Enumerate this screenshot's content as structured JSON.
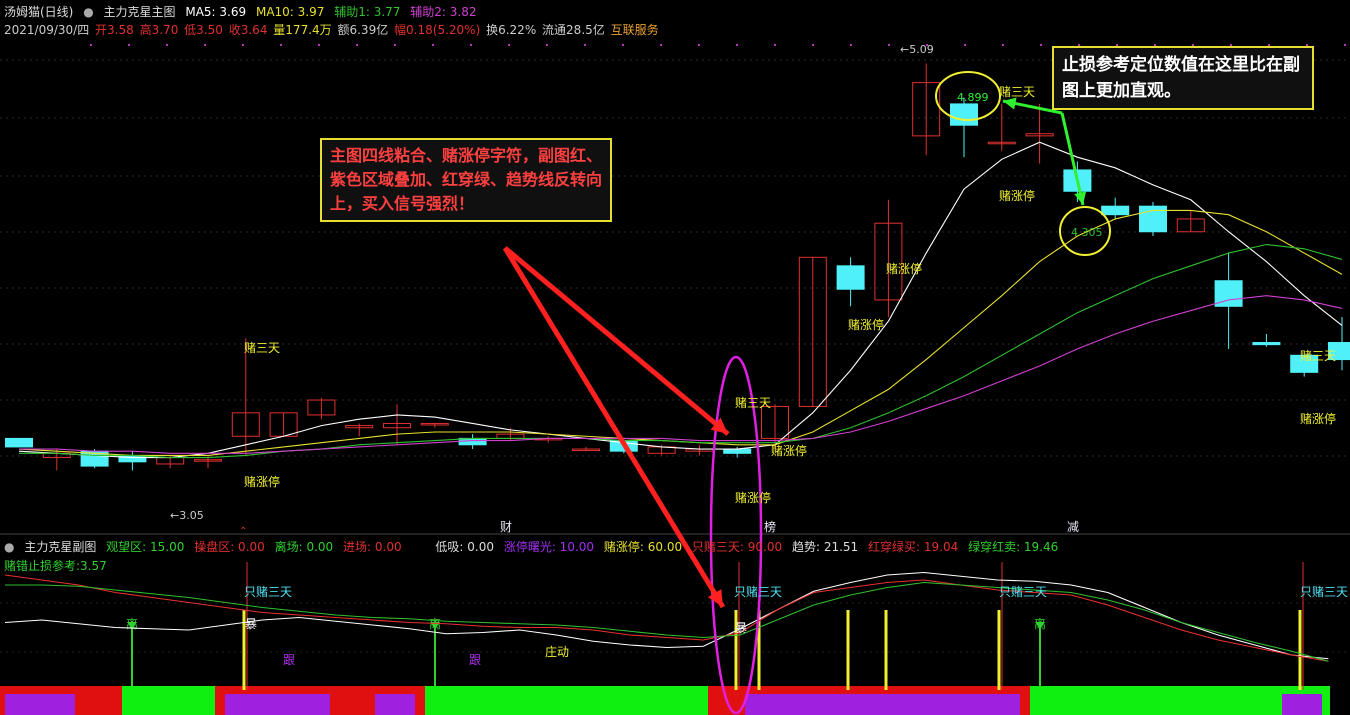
{
  "header": {
    "stock_name": "汤姆猫(日线)",
    "main_indicator": "主力克星主图",
    "ma5": "MA5: 3.69",
    "ma10": "MA10: 3.97",
    "aux1": "辅助1: 3.77",
    "aux2": "辅助2: 3.82"
  },
  "quote": {
    "date": "2021/09/30/四",
    "open": "开3.58",
    "high": "高3.70",
    "low": "低3.50",
    "close": "收3.64",
    "volume": "量177.4万",
    "amount": "额6.39亿",
    "change": "幅0.18(5.20%)",
    "turnover": "换6.22%",
    "float": "流通28.5亿",
    "sector": "互联服务"
  },
  "sub_header": {
    "indicator": "主力克星副图",
    "watch": "观望区: 15.00",
    "control": "操盘区: 0.00",
    "exit": "离场: 0.00",
    "enter": "进场: 0.00",
    "low_buy": "低吸: 0.00",
    "limit_dawn": "涨停曙光: 10.00",
    "bet_limit": "赌涨停: 60.00",
    "only_bet": "只赌三天: 90.00",
    "trend": "趋势: 21.51",
    "red_green_buy": "红穿绿买: 19.04",
    "green_red_sell": "绿穿红卖: 19.46"
  },
  "stoploss_label": "赌错止损参考:3.57",
  "callout_left": "主图四线粘合、赌涨停字符，副图红、紫色区域叠加、红穿绿、趋势线反转向上，买入信号强烈！",
  "callout_right": "止损参考定位数值在这里比在副图上更加直观。",
  "labels": {
    "high_price": "5.09",
    "low_price": "3.05",
    "stop1": "4.899",
    "stop2": "4.305",
    "bet3": "赌三天",
    "bet_limit": "赌涨停",
    "only3": "只赌三天",
    "leave": "离",
    "follow": "跟",
    "boom": "暴",
    "dealer": "庄动",
    "ev_cai": "财",
    "ev_bang": "榜",
    "ev_jian": "减"
  },
  "colors": {
    "up": "#e03030",
    "down": "#50f0f8",
    "ma_white": "#ffffff",
    "ma_yellow": "#e8e030",
    "ma_green": "#30c030",
    "ma_magenta": "#d040d0"
  },
  "chart_data": [
    {
      "type": "candlestick",
      "title": "主力克星主图",
      "ylim": [
        2.9,
        5.2
      ],
      "candles": [
        {
          "o": 3.33,
          "c": 3.29,
          "h": 3.33,
          "l": 3.29
        },
        {
          "o": 3.24,
          "c": 3.26,
          "h": 3.28,
          "l": 3.18
        },
        {
          "o": 3.27,
          "c": 3.2,
          "h": 3.28,
          "l": 3.19
        },
        {
          "o": 3.25,
          "c": 3.22,
          "h": 3.27,
          "l": 3.18
        },
        {
          "o": 3.21,
          "c": 3.24,
          "h": 3.25,
          "l": 3.19
        },
        {
          "o": 3.23,
          "c": 3.23,
          "h": 3.25,
          "l": 3.19
        },
        {
          "o": 3.34,
          "c": 3.45,
          "h": 3.8,
          "l": 3.25
        },
        {
          "o": 3.34,
          "c": 3.45,
          "h": 3.45,
          "l": 3.34
        },
        {
          "o": 3.44,
          "c": 3.51,
          "h": 3.52,
          "l": 3.42
        },
        {
          "o": 3.38,
          "c": 3.39,
          "h": 3.4,
          "l": 3.34
        },
        {
          "o": 3.38,
          "c": 3.4,
          "h": 3.49,
          "l": 3.3
        },
        {
          "o": 3.4,
          "c": 3.4,
          "h": 3.4,
          "l": 3.38
        },
        {
          "o": 3.33,
          "c": 3.3,
          "h": 3.35,
          "l": 3.28
        },
        {
          "o": 3.33,
          "c": 3.35,
          "h": 3.38,
          "l": 3.32
        },
        {
          "o": 3.33,
          "c": 3.33,
          "h": 3.34,
          "l": 3.31
        },
        {
          "o": 3.28,
          "c": 3.28,
          "h": 3.29,
          "l": 3.27
        },
        {
          "o": 3.32,
          "c": 3.27,
          "h": 3.33,
          "l": 3.26
        },
        {
          "o": 3.26,
          "c": 3.29,
          "h": 3.3,
          "l": 3.25
        },
        {
          "o": 3.27,
          "c": 3.28,
          "h": 3.3,
          "l": 3.25
        },
        {
          "o": 3.28,
          "c": 3.26,
          "h": 3.29,
          "l": 3.24
        },
        {
          "o": 3.33,
          "c": 3.48,
          "h": 3.49,
          "l": 3.28
        },
        {
          "o": 3.48,
          "c": 4.18,
          "h": 4.18,
          "l": 3.48
        },
        {
          "o": 4.14,
          "c": 4.03,
          "h": 4.18,
          "l": 3.95
        },
        {
          "o": 3.98,
          "c": 4.34,
          "h": 4.45,
          "l": 3.9
        },
        {
          "o": 4.75,
          "c": 5.0,
          "h": 5.09,
          "l": 4.66
        },
        {
          "o": 4.9,
          "c": 4.8,
          "h": 4.93,
          "l": 4.65
        },
        {
          "o": 4.72,
          "c": 4.72,
          "h": 4.9,
          "l": 4.68
        },
        {
          "o": 4.75,
          "c": 4.76,
          "h": 4.9,
          "l": 4.62
        },
        {
          "o": 4.59,
          "c": 4.49,
          "h": 4.63,
          "l": 4.44
        },
        {
          "o": 4.42,
          "c": 4.38,
          "h": 4.46,
          "l": 4.36
        },
        {
          "o": 4.42,
          "c": 4.3,
          "h": 4.44,
          "l": 4.28
        },
        {
          "o": 4.3,
          "c": 4.36,
          "h": 4.4,
          "l": 4.3
        },
        {
          "o": 4.07,
          "c": 3.95,
          "h": 4.2,
          "l": 3.75
        },
        {
          "o": 3.78,
          "c": 3.77,
          "h": 3.82,
          "l": 3.76
        },
        {
          "o": 3.72,
          "c": 3.64,
          "h": 3.72,
          "l": 3.62
        },
        {
          "o": 3.78,
          "c": 3.7,
          "h": 3.9,
          "l": 3.65
        }
      ],
      "series": [
        {
          "name": "MA5",
          "values": [
            3.27,
            3.26,
            3.25,
            3.24,
            3.24,
            3.26,
            3.3,
            3.34,
            3.39,
            3.42,
            3.44,
            3.43,
            3.4,
            3.37,
            3.35,
            3.33,
            3.31,
            3.29,
            3.28,
            3.28,
            3.3,
            3.45,
            3.65,
            3.88,
            4.2,
            4.5,
            4.64,
            4.72,
            4.65,
            4.6,
            4.52,
            4.45,
            4.3,
            4.16,
            4.0,
            3.86
          ]
        },
        {
          "name": "MA10",
          "values": [
            3.28,
            3.27,
            3.26,
            3.25,
            3.25,
            3.25,
            3.27,
            3.29,
            3.31,
            3.33,
            3.35,
            3.36,
            3.36,
            3.36,
            3.35,
            3.34,
            3.33,
            3.32,
            3.31,
            3.3,
            3.3,
            3.36,
            3.46,
            3.56,
            3.7,
            3.85,
            4.0,
            4.16,
            4.28,
            4.36,
            4.4,
            4.4,
            4.38,
            4.3,
            4.2,
            4.1
          ]
        },
        {
          "name": "辅助1",
          "values": [
            3.26,
            3.26,
            3.25,
            3.25,
            3.24,
            3.24,
            3.25,
            3.27,
            3.28,
            3.3,
            3.31,
            3.32,
            3.33,
            3.33,
            3.33,
            3.33,
            3.32,
            3.32,
            3.31,
            3.31,
            3.31,
            3.33,
            3.38,
            3.45,
            3.53,
            3.62,
            3.72,
            3.82,
            3.92,
            4.0,
            4.08,
            4.14,
            4.2,
            4.24,
            4.22,
            4.17
          ]
        },
        {
          "name": "辅助2",
          "values": [
            3.28,
            3.28,
            3.27,
            3.27,
            3.26,
            3.26,
            3.26,
            3.27,
            3.28,
            3.29,
            3.3,
            3.31,
            3.32,
            3.32,
            3.33,
            3.33,
            3.33,
            3.33,
            3.32,
            3.32,
            3.32,
            3.33,
            3.36,
            3.41,
            3.47,
            3.53,
            3.6,
            3.67,
            3.75,
            3.82,
            3.88,
            3.93,
            3.98,
            4.0,
            3.98,
            3.94
          ]
        }
      ]
    },
    {
      "type": "line",
      "title": "主力克星副图",
      "series": [
        {
          "name": "趋势",
          "values": [
            50,
            52,
            49,
            46,
            45,
            44,
            48,
            52,
            54,
            51,
            48,
            45,
            41,
            42,
            44,
            40,
            35,
            32,
            30,
            31,
            45,
            60,
            75,
            82,
            88,
            90,
            87,
            84,
            83,
            80,
            74,
            62,
            50,
            40,
            32,
            24,
            21
          ]
        },
        {
          "name": "红穿绿买",
          "values": [
            88,
            84,
            80,
            74,
            70,
            66,
            62,
            58,
            56,
            54,
            52,
            50,
            49,
            47,
            46,
            46,
            44,
            40,
            38,
            36,
            42,
            60,
            74,
            78,
            82,
            84,
            80,
            76,
            74,
            72,
            64,
            54,
            44,
            36,
            30,
            24,
            19
          ]
        },
        {
          "name": "绿穿红卖",
          "values": [
            80,
            80,
            79,
            76,
            73,
            70,
            66,
            62,
            59,
            56,
            54,
            53,
            51,
            50,
            49,
            48,
            46,
            43,
            40,
            38,
            40,
            52,
            64,
            72,
            78,
            82,
            80,
            78,
            76,
            74,
            68,
            60,
            50,
            42,
            34,
            27,
            19
          ]
        }
      ]
    }
  ]
}
